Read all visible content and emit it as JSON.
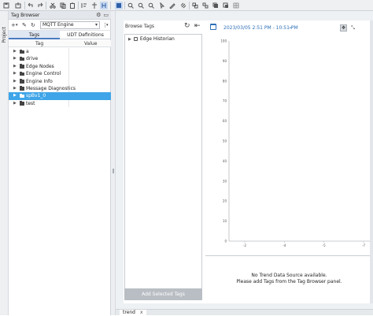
{
  "tag_browser": {
    "title": "Tag Browser",
    "provider": "MQTT Engine",
    "tabs": [
      "Tags",
      "UDT Definitions"
    ],
    "columns": [
      "Tag",
      "Value"
    ],
    "tree": [
      {
        "name": "a",
        "selected": false
      },
      {
        "name": "drive",
        "selected": false
      },
      {
        "name": "Edge Nodes",
        "selected": false
      },
      {
        "name": "Engine Control",
        "selected": false
      },
      {
        "name": "Engine Info",
        "selected": false
      },
      {
        "name": "Message Diagnostics",
        "selected": false
      },
      {
        "name": "spBv1_0",
        "selected": true
      },
      {
        "name": "test",
        "selected": false
      }
    ]
  },
  "side_tab": {
    "label": "Project"
  },
  "browse_tags": {
    "title": "Browse Tags",
    "items": [
      "Edge Historian"
    ],
    "add_button": "Add Selected Tags"
  },
  "chart": {
    "date_range": "2023/03/05 2:51 PM - 10:51 PM",
    "no_data_line1": "No Trend Data Source available.",
    "no_data_line2": "Please add Tags from the Tag Browser panel.",
    "chart_data": {
      "type": "line",
      "y_ticks": [
        0,
        10,
        20,
        30,
        40,
        50,
        60,
        70,
        80,
        90,
        100
      ],
      "x_ticks": [
        "-2",
        "-4",
        "-5",
        "-7"
      ],
      "ylim": [
        0,
        100
      ],
      "series": []
    }
  },
  "bottom": {
    "tab_label": "trend",
    "tab_close": "x"
  },
  "colors": {
    "accent": "#2d6fb8",
    "selection": "#3fa5e8"
  }
}
